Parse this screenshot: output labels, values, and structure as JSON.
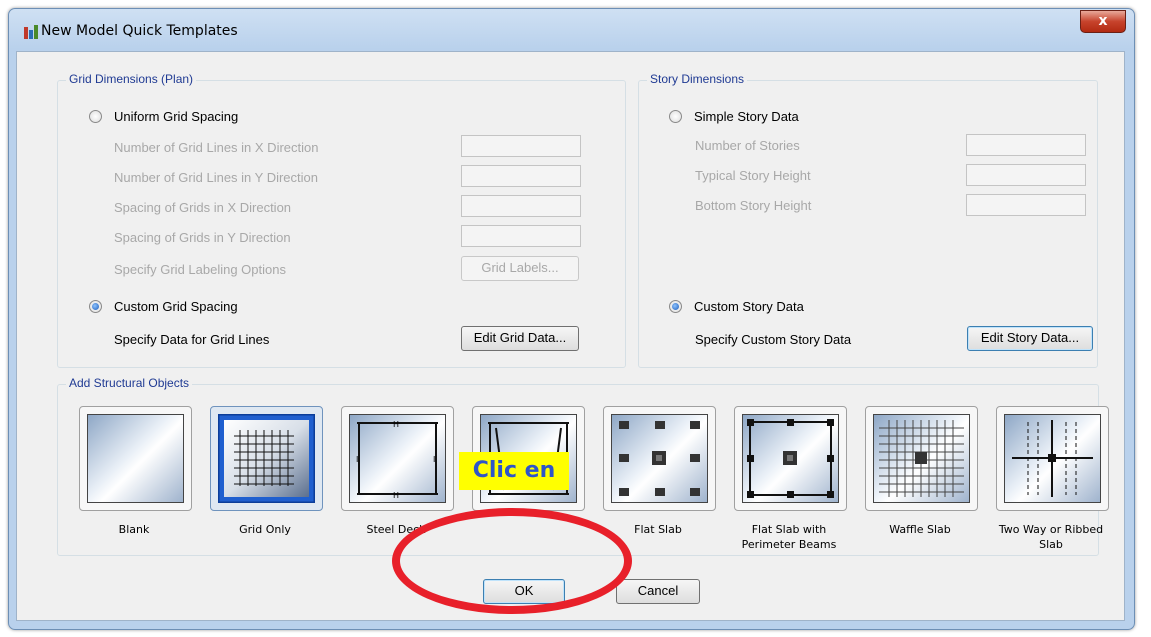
{
  "window": {
    "title": "New Model Quick Templates",
    "close_label": "x"
  },
  "grid_dimensions": {
    "title": "Grid Dimensions (Plan)",
    "uniform_option": "Uniform Grid Spacing",
    "uniform_selected": false,
    "fields": [
      {
        "label": "Number of Grid Lines in X Direction",
        "value": ""
      },
      {
        "label": "Number of Grid Lines in Y Direction",
        "value": ""
      },
      {
        "label": "Spacing of Grids in X Direction",
        "value": ""
      },
      {
        "label": "Spacing of Grids in Y Direction",
        "value": ""
      }
    ],
    "labeling_label": "Specify Grid Labeling Options",
    "grid_labels_button": "Grid Labels...",
    "custom_option": "Custom Grid Spacing",
    "custom_selected": true,
    "custom_label": "Specify Data for Grid Lines",
    "edit_grid_button": "Edit Grid Data..."
  },
  "story_dimensions": {
    "title": "Story Dimensions",
    "simple_option": "Simple Story Data",
    "simple_selected": false,
    "fields": [
      {
        "label": "Number of Stories",
        "value": ""
      },
      {
        "label": "Typical Story Height",
        "value": ""
      },
      {
        "label": "Bottom Story Height",
        "value": ""
      }
    ],
    "custom_option": "Custom Story Data",
    "custom_selected": true,
    "custom_label": "Specify Custom Story Data",
    "edit_story_button": "Edit Story Data..."
  },
  "structural_objects": {
    "title": "Add Structural Objects",
    "tiles": [
      {
        "label": "Blank",
        "selected": false
      },
      {
        "label": "Grid Only",
        "selected": true
      },
      {
        "label": "Steel Deck",
        "selected": false
      },
      {
        "label": "",
        "selected": false
      },
      {
        "label": "Flat Slab",
        "selected": false
      },
      {
        "label": "Flat Slab with Perimeter Beams",
        "selected": false
      },
      {
        "label": "Waffle Slab",
        "selected": false
      },
      {
        "label": "Two Way or Ribbed Slab",
        "selected": false
      }
    ]
  },
  "footer": {
    "ok_label": "OK",
    "cancel_label": "Cancel"
  },
  "annotation": {
    "text": "Clic en",
    "highlight_color": "#ffff00",
    "ellipse_color": "#e8202a"
  }
}
